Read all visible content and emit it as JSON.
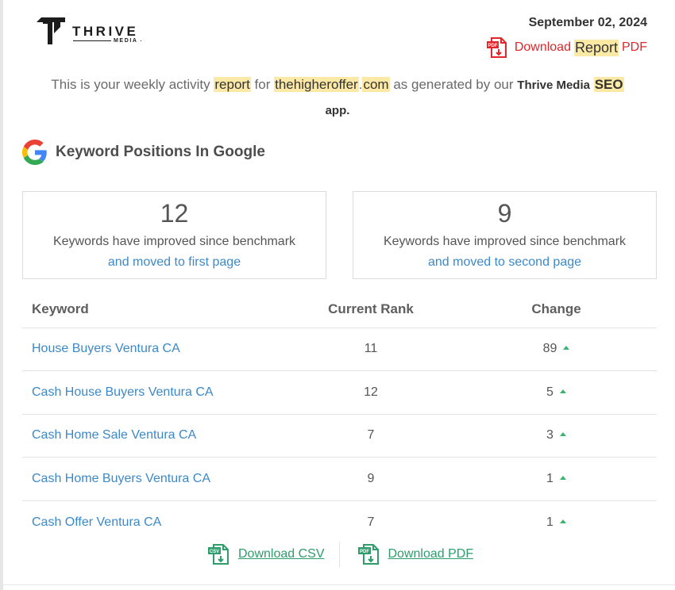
{
  "brand": {
    "name": "THRIVE",
    "sub": "MEDIA"
  },
  "header": {
    "date": "September 02, 2024",
    "download_prefix": "Download",
    "download_highlight": "Report",
    "download_suffix": "PDF"
  },
  "intro": {
    "t1": "This is your weekly activity",
    "h1": "report",
    "t2": "for",
    "h2": "thehigheroffer",
    "t3": ".",
    "h3": "com",
    "t4": "as generated by our",
    "b1": "Thrive Media",
    "h4": "SEO",
    "b2": "app."
  },
  "section": {
    "title": "Keyword Positions In Google"
  },
  "stats": [
    {
      "number": "12",
      "desc": "Keywords have improved since benchmark",
      "sub": "and moved to first page"
    },
    {
      "number": "9",
      "desc": "Keywords have improved since benchmark",
      "sub": "and moved to second page"
    }
  ],
  "table": {
    "headers": [
      "Keyword",
      "Current Rank",
      "Change"
    ],
    "rows": [
      {
        "keyword": "House Buyers Ventura CA",
        "rank": "11",
        "change": "89"
      },
      {
        "keyword": "Cash House Buyers Ventura CA",
        "rank": "12",
        "change": "5"
      },
      {
        "keyword": "Cash Home Sale Ventura CA",
        "rank": "7",
        "change": "3"
      },
      {
        "keyword": "Cash Home Buyers Ventura CA",
        "rank": "9",
        "change": "1"
      },
      {
        "keyword": "Cash Offer Ventura CA",
        "rank": "7",
        "change": "1"
      }
    ]
  },
  "downloads": {
    "csv_label": "Download CSV",
    "pdf_label": "Download PDF",
    "csv_icon_text": "CSV",
    "pdf_icon_text": "PDF"
  },
  "colors": {
    "link": "#3c89c9",
    "highlight": "#fde9a6",
    "pdf_red": "#e0262b",
    "download_green": "#2e9d6b",
    "arrow_up": "#3cb371"
  },
  "icons": [
    "thrive-logo-icon",
    "pdf-file-icon",
    "google-g-icon",
    "csv-file-icon",
    "arrow-up-icon"
  ]
}
